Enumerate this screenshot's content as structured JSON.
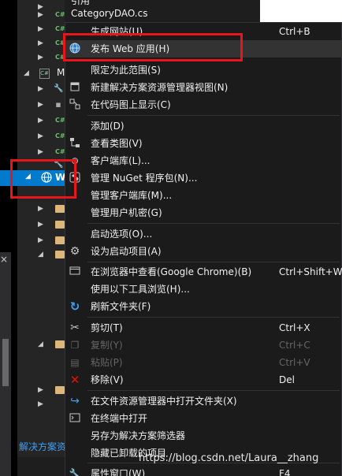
{
  "file_header": {
    "top_fragment": "引用",
    "filename": "CategoryDAO.cs"
  },
  "tree": {
    "selected_label": "W",
    "letter_m": "M",
    "rows": [
      {
        "icon": "cs-file-icon"
      },
      {
        "icon": "cs-file-icon"
      },
      {
        "icon": "cs-file-icon"
      },
      {
        "icon": "cs-project-icon"
      },
      {
        "icon": "wrench-icon"
      },
      {
        "icon": "references-icon"
      },
      {
        "icon": "cs-file-icon"
      },
      {
        "icon": "cs-file-icon"
      },
      {
        "icon": "cs-file-icon"
      },
      {
        "icon": "wrench-icon"
      },
      {
        "icon": "folder-icon"
      },
      {
        "icon": "folder-icon"
      },
      {
        "icon": "folder-icon"
      },
      {
        "icon": "folder-icon"
      }
    ]
  },
  "context_menu": {
    "items": [
      {
        "label": "生成网站(U)",
        "shortcut": "Ctrl+B",
        "icon": "build-icon",
        "enabled": true
      },
      {
        "label": "发布 Web 应用(H)",
        "shortcut": "",
        "icon": "globe-icon",
        "enabled": true
      },
      {
        "label": "限定为此范围(S)",
        "shortcut": "",
        "icon": "",
        "enabled": true
      },
      {
        "label": "新建解决方案资源管理器视图(N)",
        "shortcut": "",
        "icon": "new-view-icon",
        "enabled": true
      },
      {
        "label": "在代码图上显示(C)",
        "shortcut": "",
        "icon": "code-map-icon",
        "enabled": true
      },
      {
        "label": "添加(D)",
        "shortcut": "",
        "icon": "",
        "enabled": true
      },
      {
        "label": "查看类图(V)",
        "shortcut": "",
        "icon": "class-diagram-icon",
        "enabled": true
      },
      {
        "label": "客户端库(L)...",
        "shortcut": "",
        "icon": "client-lib-icon",
        "enabled": true
      },
      {
        "label": "管理 NuGet 程序包(N)...",
        "shortcut": "",
        "icon": "nuget-icon",
        "enabled": true
      },
      {
        "label": "管理客户端库(M)...",
        "shortcut": "",
        "icon": "",
        "enabled": true
      },
      {
        "label": "管理用户机密(G)",
        "shortcut": "",
        "icon": "",
        "enabled": true
      },
      {
        "label": "启动选项(O)...",
        "shortcut": "",
        "icon": "",
        "enabled": true
      },
      {
        "label": "设为启动项目(A)",
        "shortcut": "",
        "icon": "gear-icon",
        "enabled": true
      },
      {
        "label": "在浏览器中查看(Google Chrome)(B)",
        "shortcut": "Ctrl+Shift+W",
        "icon": "browser-icon",
        "enabled": true
      },
      {
        "label": "使用以下工具浏览(H)...",
        "shortcut": "",
        "icon": "",
        "enabled": true
      },
      {
        "label": "刷新文件夹(F)",
        "shortcut": "",
        "icon": "refresh-icon",
        "enabled": true
      },
      {
        "label": "剪切(T)",
        "shortcut": "Ctrl+X",
        "icon": "cut-icon",
        "enabled": true
      },
      {
        "label": "复制(Y)",
        "shortcut": "Ctrl+C",
        "icon": "copy-icon",
        "enabled": false
      },
      {
        "label": "粘贴(P)",
        "shortcut": "Ctrl+V",
        "icon": "paste-icon",
        "enabled": false
      },
      {
        "label": "移除(V)",
        "shortcut": "Del",
        "icon": "remove-icon",
        "enabled": true
      },
      {
        "label": "在文件资源管理器中打开文件夹(X)",
        "shortcut": "",
        "icon": "open-folder-icon",
        "enabled": true
      },
      {
        "label": "在终端中打开",
        "shortcut": "",
        "icon": "terminal-icon",
        "enabled": true
      },
      {
        "label": "另存为解决方案筛选器",
        "shortcut": "",
        "icon": "",
        "enabled": true
      },
      {
        "label": "隐藏已卸载的项目",
        "shortcut": "",
        "icon": "",
        "enabled": true
      },
      {
        "label": "属性窗口(W)",
        "shortcut": "F4",
        "icon": "wrench-icon",
        "enabled": true
      }
    ]
  },
  "left_panel": {
    "close_glyph": "×",
    "bottom_link": "解决方案资"
  },
  "watermark": "https://blog.csdn.net/Laura__zhang",
  "colors": {
    "selection": "#007acc",
    "annotation_red": "#e8151b",
    "menu_bg": "#1b1b1c"
  }
}
